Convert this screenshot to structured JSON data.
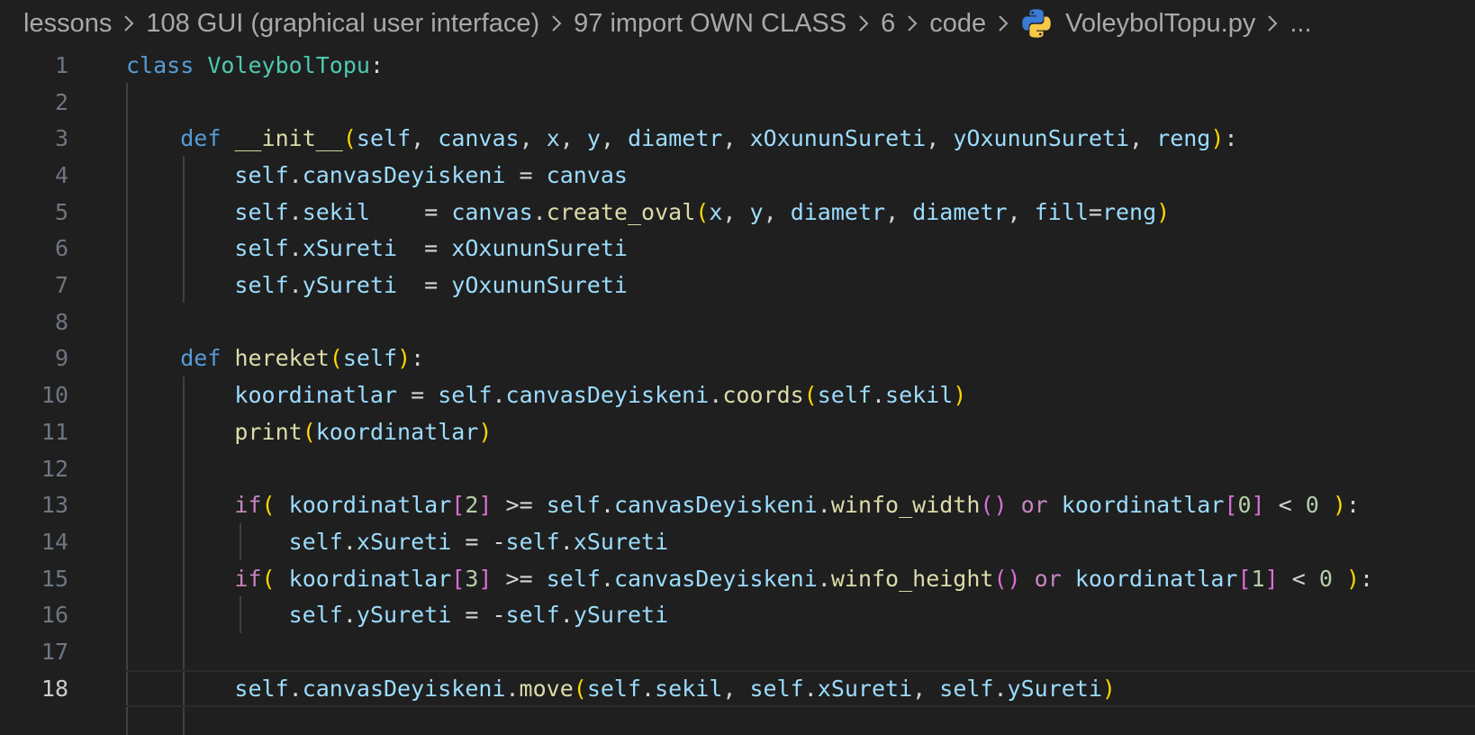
{
  "breadcrumb": {
    "items": [
      "lessons",
      "108 GUI (graphical user interface)",
      "97 import OWN CLASS",
      "6",
      "code"
    ],
    "file": "VoleybolTopu.py",
    "overflow": "..."
  },
  "editor": {
    "language": "python",
    "active_line": 18,
    "line_numbers": [
      "1",
      "2",
      "3",
      "4",
      "5",
      "6",
      "7",
      "8",
      "9",
      "10",
      "11",
      "12",
      "13",
      "14",
      "15",
      "16",
      "17",
      "18"
    ],
    "lines": [
      "class VoleybolTopu:",
      "",
      "    def __init__(self, canvas, x, y, diametr, xOxununSureti, yOxununSureti, reng):",
      "        self.canvasDeyiskeni = canvas",
      "        self.sekil    = canvas.create_oval(x, y, diametr, diametr, fill=reng)",
      "        self.xSureti  = xOxununSureti",
      "        self.ySureti  = yOxununSureti",
      "",
      "    def hereket(self):",
      "        koordinatlar = self.canvasDeyiskeni.coords(self.sekil)",
      "        print(koordinatlar)",
      "",
      "        if( koordinatlar[2] >= self.canvasDeyiskeni.winfo_width() or koordinatlar[0] < 0 ):",
      "            self.xSureti = -self.xSureti",
      "        if( koordinatlar[3] >= self.canvasDeyiskeni.winfo_height() or koordinatlar[1] < 0 ):",
      "            self.ySureti = -self.ySureti",
      "",
      "        self.canvasDeyiskeni.move(self.sekil, self.xSureti, self.ySureti)"
    ]
  },
  "colors": {
    "background": "#1f1f1f",
    "keyword": "#569cd6",
    "control_keyword": "#c586c0",
    "class_name": "#4ec9b0",
    "function": "#dcdcaa",
    "variable": "#9cdcfe",
    "number": "#b5cea8",
    "bracket_level1": "#ffd700",
    "bracket_level2": "#da70d6"
  },
  "icons": {
    "chevron": "chevron-right-icon",
    "file_type": "python-icon"
  }
}
